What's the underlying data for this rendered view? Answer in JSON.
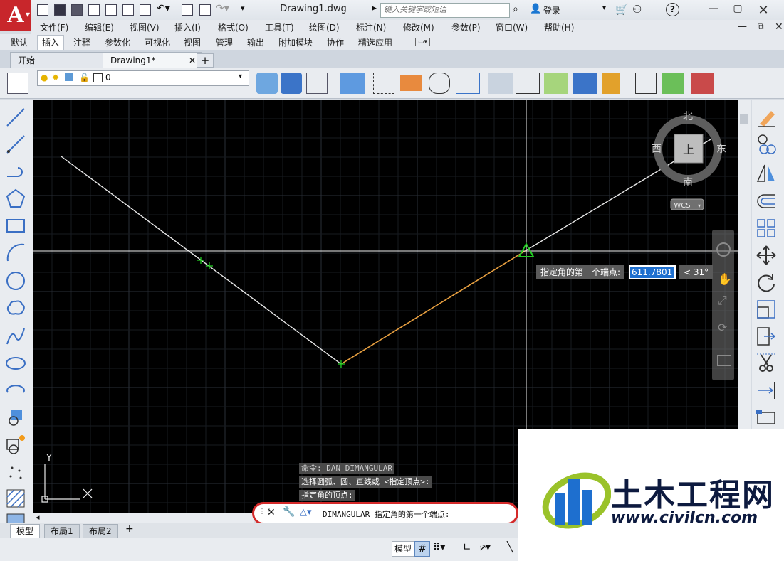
{
  "app": {
    "logo_letter": "A",
    "document_title": "Drawing1.dwg"
  },
  "search": {
    "placeholder": "键入关键字或短语"
  },
  "account": {
    "login_label": "登录"
  },
  "menu": [
    "文件(F)",
    "编辑(E)",
    "视图(V)",
    "插入(I)",
    "格式(O)",
    "工具(T)",
    "绘图(D)",
    "标注(N)",
    "修改(M)",
    "参数(P)",
    "窗口(W)",
    "帮助(H)"
  ],
  "ribbon_tabs": [
    {
      "label": "默认",
      "active": false
    },
    {
      "label": "插入",
      "active": true
    },
    {
      "label": "注释",
      "active": false
    },
    {
      "label": "参数化",
      "active": false
    },
    {
      "label": "可视化",
      "active": false
    },
    {
      "label": "视图",
      "active": false
    },
    {
      "label": "管理",
      "active": false
    },
    {
      "label": "输出",
      "active": false
    },
    {
      "label": "附加模块",
      "active": false
    },
    {
      "label": "协作",
      "active": false
    },
    {
      "label": "精选应用",
      "active": false
    }
  ],
  "doc_tabs": [
    {
      "label": "开始",
      "active": false
    },
    {
      "label": "Drawing1*",
      "active": true
    }
  ],
  "layer": {
    "current": "0"
  },
  "viewcube": {
    "north": "北",
    "south": "南",
    "west": "西",
    "east": "东",
    "face": "上",
    "ucs_label": "WCS"
  },
  "dynamic_input": {
    "prompt": "指定角的第一个端点:",
    "value": "611.7801",
    "angle": "< 31°"
  },
  "command_history": [
    "命令: DAN DIMANGULAR",
    "选择圆弧、圆、直线或 <指定顶点>:",
    "指定角的顶点:"
  ],
  "command_line": {
    "text": "DIMANGULAR 指定角的第一个端点:"
  },
  "ucs_icon": {
    "x_label": "X",
    "y_label": "Y"
  },
  "layout_tabs": [
    {
      "label": "模型",
      "active": true
    },
    {
      "label": "布局1",
      "active": false
    },
    {
      "label": "布局2",
      "active": false
    }
  ],
  "status": {
    "model_label": "模型"
  },
  "watermark": {
    "title": "土木工程网",
    "url": "www.civilcn.com"
  },
  "colors": {
    "canvas": "#000000",
    "accent": "#c8262b",
    "preview_line": "#e8a040",
    "cursor": "#ffffff",
    "marker": "#22cc22",
    "highlight": "#d42a2a"
  }
}
